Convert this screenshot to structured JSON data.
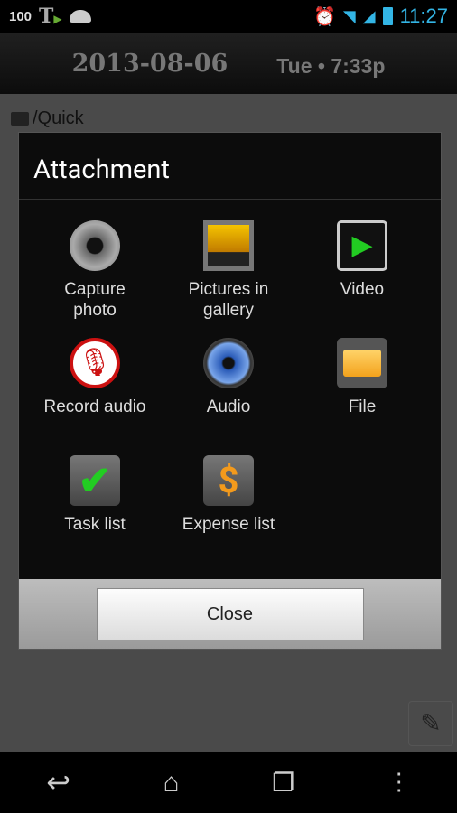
{
  "status_bar": {
    "battery_text": "100",
    "time": "11:27",
    "icons": [
      "t-app-icon",
      "android-icon",
      "alarm-icon",
      "wifi-icon",
      "signal-icon",
      "battery-charging-icon"
    ]
  },
  "header": {
    "date": "2013-08-06",
    "day_time": "Tue • 7:33p"
  },
  "content": {
    "folder": "/Quick"
  },
  "dialog": {
    "title": "Attachment",
    "items": [
      {
        "label": "Capture photo",
        "icon": "camera-icon"
      },
      {
        "label": "Pictures in gallery",
        "icon": "gallery-icon"
      },
      {
        "label": "Video",
        "icon": "video-icon"
      },
      {
        "label": "Record audio",
        "icon": "microphone-icon"
      },
      {
        "label": "Audio",
        "icon": "speaker-icon"
      },
      {
        "label": "File",
        "icon": "folder-icon"
      },
      {
        "label": "Task list",
        "icon": "checkmark-icon"
      },
      {
        "label": "Expense list",
        "icon": "dollar-icon"
      }
    ],
    "close_label": "Close"
  },
  "colors": {
    "accent": "#33b5e5"
  }
}
